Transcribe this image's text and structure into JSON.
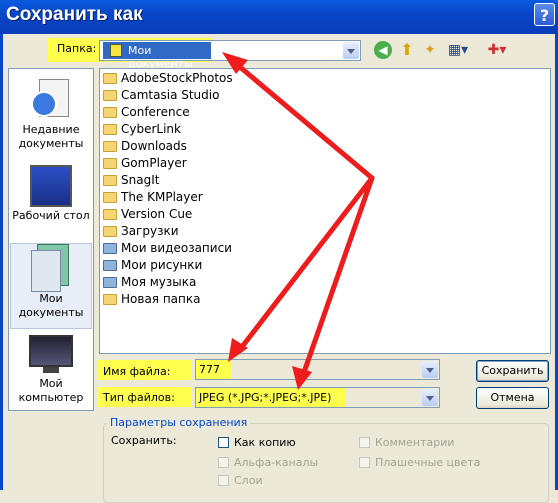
{
  "window": {
    "title": "Сохранить как",
    "help_label": "?"
  },
  "folder": {
    "label": "Папка:",
    "value": "Мои документы"
  },
  "places": [
    {
      "label": "Недавние документы"
    },
    {
      "label": "Рабочий стол"
    },
    {
      "label": "Мои документы"
    },
    {
      "label": "Мой компьютер"
    }
  ],
  "files": [
    {
      "name": "AdobeStockPhotos"
    },
    {
      "name": "Camtasia Studio"
    },
    {
      "name": "Conference"
    },
    {
      "name": "CyberLink"
    },
    {
      "name": "Downloads"
    },
    {
      "name": "GomPlayer"
    },
    {
      "name": "SnagIt"
    },
    {
      "name": "The KMPlayer"
    },
    {
      "name": "Version Cue"
    },
    {
      "name": "Загрузки"
    },
    {
      "name": "Мои видеозаписи"
    },
    {
      "name": "Мои рисунки"
    },
    {
      "name": "Моя музыка"
    },
    {
      "name": "Новая папка"
    }
  ],
  "filename": {
    "label": "Имя файла:",
    "value": "777"
  },
  "filetype": {
    "label": "Тип файлов:",
    "value": "JPEG (*.JPG;*.JPEG;*.JPE)"
  },
  "buttons": {
    "save": "Сохранить",
    "cancel": "Отмена"
  },
  "options": {
    "title": "Параметры сохранения",
    "save_label": "Сохранить:",
    "as_copy": "Как копию",
    "comments": "Комментарии",
    "alpha": "Альфа-каналы",
    "spot": "Плашечные цвета",
    "layers": "Слои"
  },
  "colors": {
    "highlight": "#ffff4d",
    "arrow": "#ee1c1c",
    "titlebar": "#0846c8"
  }
}
